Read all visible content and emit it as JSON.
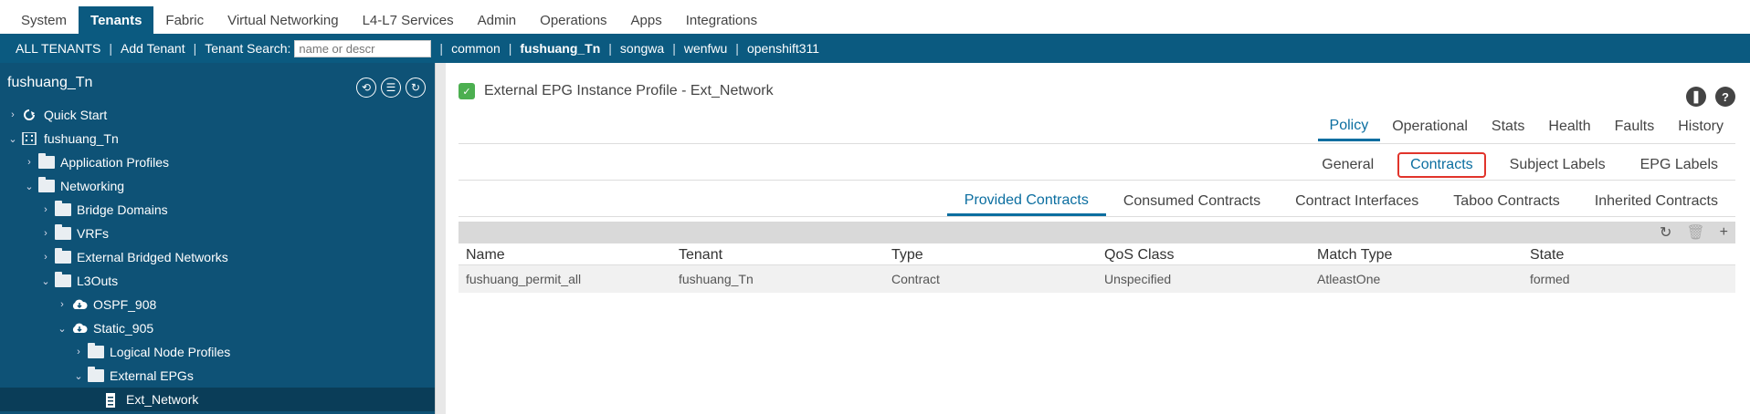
{
  "topnav": [
    "System",
    "Tenants",
    "Fabric",
    "Virtual Networking",
    "L4-L7 Services",
    "Admin",
    "Operations",
    "Apps",
    "Integrations"
  ],
  "tenantbar": {
    "all": "ALL TENANTS",
    "add": "Add Tenant",
    "search_label": "Tenant Search:",
    "search_placeholder": "name or descr",
    "tenants": [
      "common",
      "fushuang_Tn",
      "songwa",
      "wenfwu",
      "openshift311"
    ]
  },
  "sidebar": {
    "title": "fushuang_Tn",
    "tree": [
      {
        "label": "Quick Start",
        "icon": "quick-start-icon"
      },
      {
        "label": "fushuang_Tn",
        "icon": "tenant-icon"
      },
      {
        "label": "Application Profiles",
        "icon": "folder-icon"
      },
      {
        "label": "Networking",
        "icon": "folder-icon"
      },
      {
        "label": "Bridge Domains",
        "icon": "folder-icon"
      },
      {
        "label": "VRFs",
        "icon": "folder-icon"
      },
      {
        "label": "External Bridged Networks",
        "icon": "folder-icon"
      },
      {
        "label": "L3Outs",
        "icon": "folder-icon"
      },
      {
        "label": "OSPF_908",
        "icon": "cloud-icon"
      },
      {
        "label": "Static_905",
        "icon": "cloud-icon"
      },
      {
        "label": "Logical Node Profiles",
        "icon": "folder-icon"
      },
      {
        "label": "External EPGs",
        "icon": "folder-icon"
      },
      {
        "label": "Ext_Network",
        "icon": "document-icon"
      }
    ]
  },
  "main": {
    "title": "External EPG Instance Profile - Ext_Network",
    "tabs1": [
      "Policy",
      "Operational",
      "Stats",
      "Health",
      "Faults",
      "History"
    ],
    "tabs2": [
      "General",
      "Contracts",
      "Subject Labels",
      "EPG Labels"
    ],
    "tabs3": [
      "Provided Contracts",
      "Consumed Contracts",
      "Contract Interfaces",
      "Taboo Contracts",
      "Inherited Contracts"
    ],
    "columns": [
      "Name",
      "Tenant",
      "Type",
      "QoS Class",
      "Match Type",
      "State"
    ],
    "rows": [
      [
        "fushuang_permit_all",
        "fushuang_Tn",
        "Contract",
        "Unspecified",
        "AtleastOne",
        "formed"
      ]
    ]
  }
}
